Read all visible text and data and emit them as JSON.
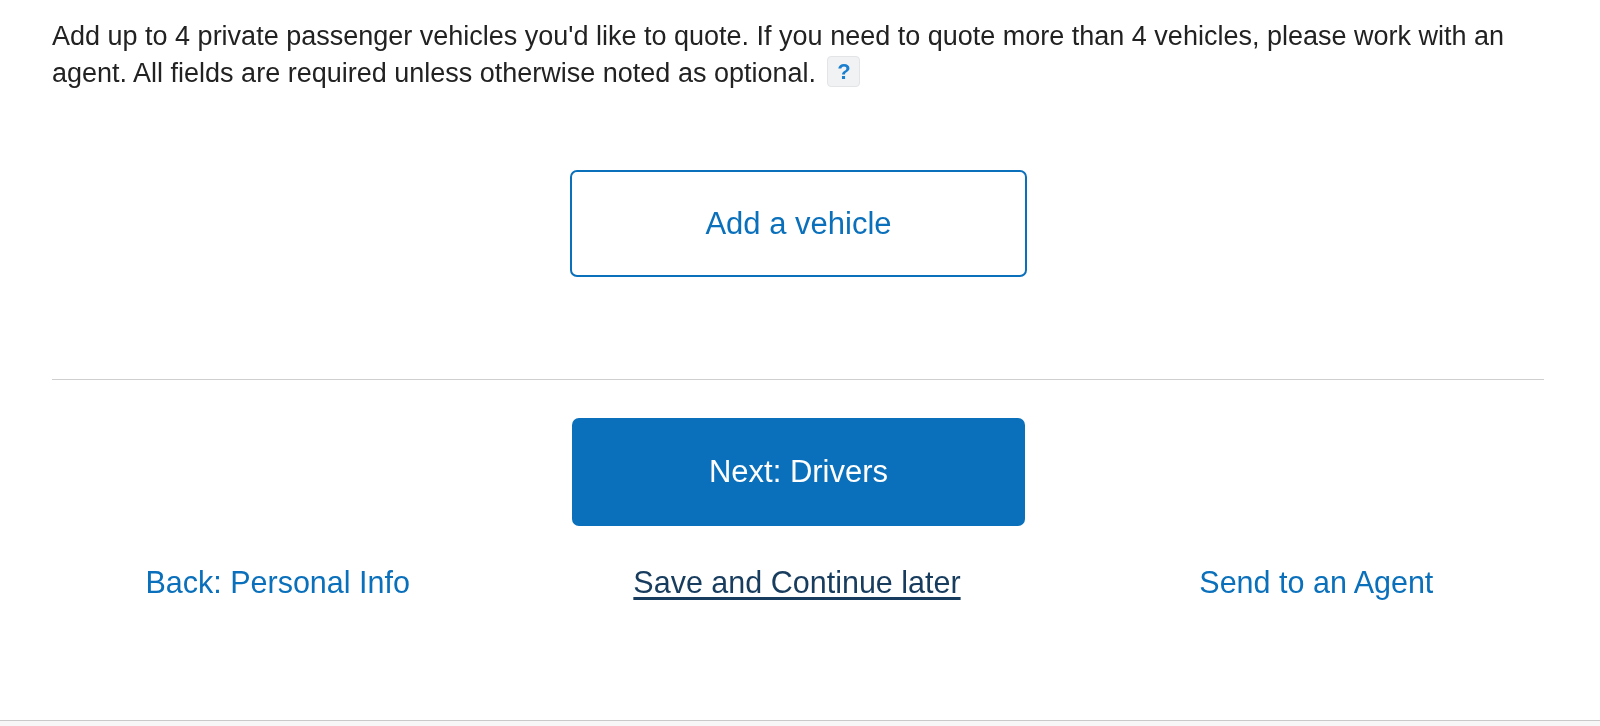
{
  "instructions": {
    "text": "Add up to 4 private passenger vehicles you'd like to quote. If you need to quote more than 4 vehicles, please work with an agent. All fields are required unless otherwise noted as optional.",
    "help_label": "?"
  },
  "add_vehicle_button": {
    "label": "Add a vehicle"
  },
  "next_button": {
    "label": "Next: Drivers"
  },
  "links": [
    {
      "label": "Back: Personal Info",
      "kind": "nav"
    },
    {
      "label": "Save and Continue later",
      "kind": "save"
    },
    {
      "label": "Send to an Agent",
      "kind": "nav"
    }
  ]
}
